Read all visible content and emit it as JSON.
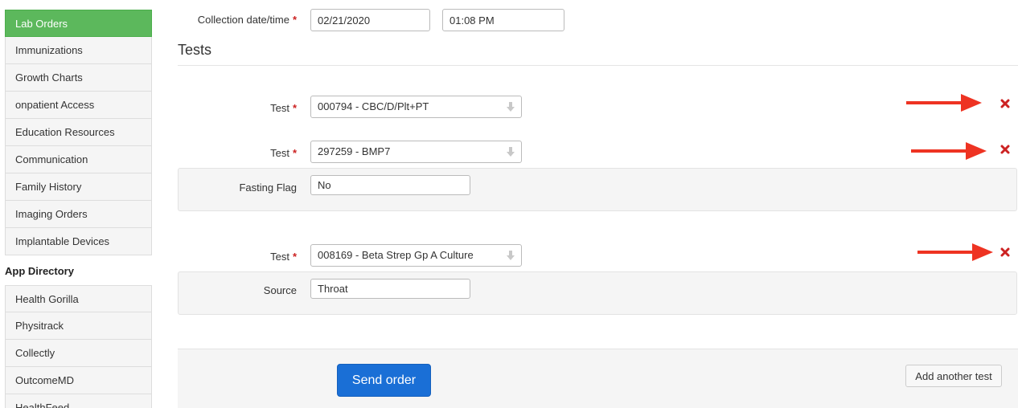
{
  "sidebar": {
    "items": [
      {
        "label": "Lab Orders",
        "active": true
      },
      {
        "label": "Immunizations"
      },
      {
        "label": "Growth Charts"
      },
      {
        "label": "onpatient Access"
      },
      {
        "label": "Education Resources"
      },
      {
        "label": "Communication"
      },
      {
        "label": "Family History"
      },
      {
        "label": "Imaging Orders"
      },
      {
        "label": "Implantable Devices"
      }
    ],
    "app_directory_header": "App Directory",
    "apps": [
      {
        "label": "Health Gorilla"
      },
      {
        "label": "Physitrack"
      },
      {
        "label": "Collectly"
      },
      {
        "label": "OutcomeMD"
      },
      {
        "label": "HealthFeed"
      }
    ]
  },
  "collection": {
    "label": "Collection date/time",
    "required_mark": "*",
    "date": "02/21/2020",
    "time": "01:08 PM"
  },
  "tests_heading": "Tests",
  "tests": [
    {
      "label": "Test",
      "required_mark": "*",
      "value": "000794 - CBC/D/Plt+PT"
    },
    {
      "label": "Test",
      "required_mark": "*",
      "value": "297259 - BMP7",
      "detail_label": "Fasting Flag",
      "detail_value": "No"
    },
    {
      "label": "Test",
      "required_mark": "*",
      "value": "008169 - Beta Strep Gp A Culture",
      "detail_label": "Source",
      "detail_value": "Throat"
    }
  ],
  "actions": {
    "send_order": "Send order",
    "add_another_test": "Add another test"
  },
  "colors": {
    "active_nav": "#5cb85c",
    "primary_button": "#1a6fd6",
    "remove_icon": "#cc2222",
    "annotation_arrow": "#ee3322"
  },
  "icons": {
    "remove": "remove-x-icon",
    "select_caret": "select-arrow-icon",
    "annotation": "red-arrow-annotation"
  }
}
